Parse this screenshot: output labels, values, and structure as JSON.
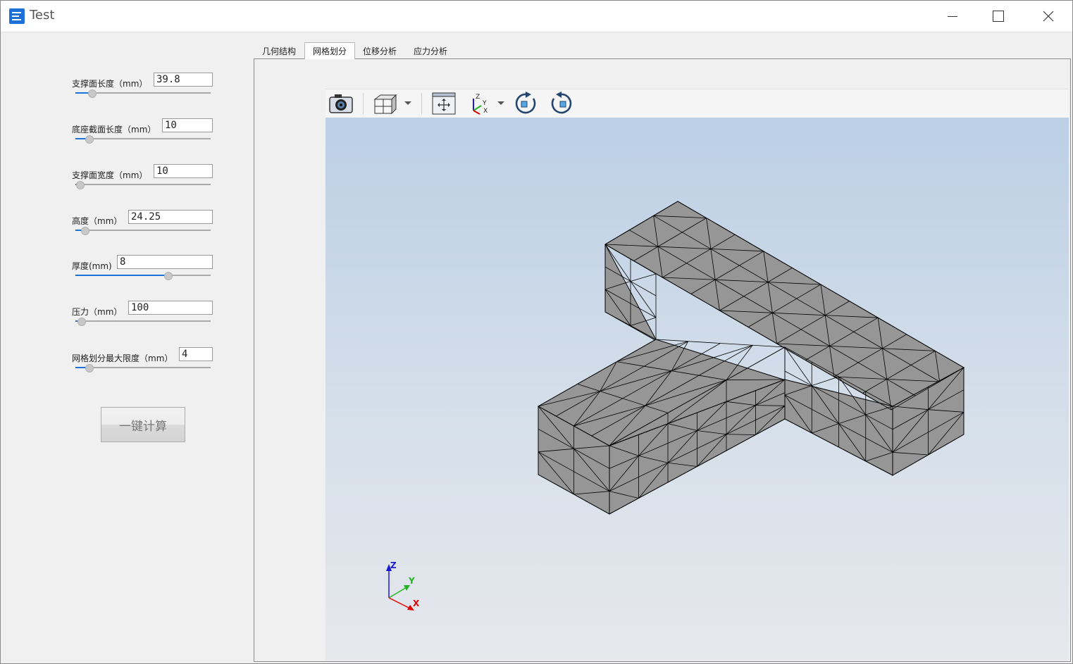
{
  "window": {
    "title": "Test"
  },
  "params": [
    {
      "label": "支撑面长度（mm）",
      "value": "39.8",
      "slider": 0.12
    },
    {
      "label": "底座截面长度（mm）",
      "value": "10",
      "slider": 0.1
    },
    {
      "label": "支撑面宽度（mm）",
      "value": "10",
      "slider": 0.03
    },
    {
      "label": "高度（mm）",
      "value": "24.25",
      "slider": 0.07
    },
    {
      "label": "厚度(mm)",
      "value": "8",
      "slider": 0.68
    },
    {
      "label": "压力（mm）",
      "value": "100",
      "slider": 0.04
    },
    {
      "label": "网格划分最大限度（mm）",
      "value": "4",
      "slider": 0.1
    }
  ],
  "calc_button": "一键计算",
  "tabs": [
    {
      "label": "几何结构",
      "active": false
    },
    {
      "label": "网格划分",
      "active": true
    },
    {
      "label": "位移分析",
      "active": false
    },
    {
      "label": "应力分析",
      "active": false
    }
  ],
  "toolbar": {
    "icons": [
      "camera-icon",
      "view-cube-icon",
      "fit-view-icon",
      "axes-orientation-icon",
      "rotate-cw-icon",
      "rotate-ccw-icon"
    ]
  },
  "triad": {
    "x_label": "X",
    "y_label": "Y",
    "z_label": "Z"
  },
  "toolbar_axes": {
    "x_label": "X",
    "y_label": "Y",
    "z_label": "Z"
  },
  "colors": {
    "accent": "#1e73d8",
    "mesh_fill": "#969696",
    "mesh_edge": "#000000",
    "axis_x": "#e00000",
    "axis_y": "#22b522",
    "axis_z": "#1a1ad6"
  }
}
